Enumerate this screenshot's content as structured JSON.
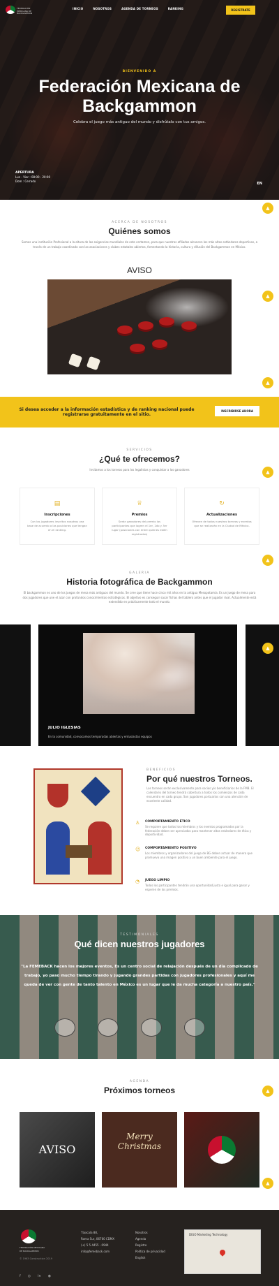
{
  "header": {
    "logo_text": "FEDERACIÓN MEXICANA DE BACKGAMMON",
    "nav": [
      "INICIO",
      "NOSOTROS",
      "AGENDA DE TORNEOS",
      "RANKING"
    ],
    "register_button": "REGISTRATE"
  },
  "hero": {
    "welcome": "BIENVENIDO A",
    "title": "Federación Mexicana de Backgammon",
    "subtitle": "Celebra el juego más antiguo del mundo y disfrútalo con tus amigos.",
    "hours_title": "APERTURA",
    "hours_week": "Lun - Vier : 08:00 - 20:00",
    "hours_sun": "Dom : Cerrado",
    "language": "EN"
  },
  "about": {
    "eyebrow": "ACERCA DE NOSOTROS",
    "title": "Quiénes somos",
    "text": "Somos una institución Profesional a la altura de las exigencias mundiales de este certamen, para que nuestros afiliados alcancen los más altos estándares deportivos, a través de un trabajo coordinado con las asociaciones y clubes estatales abiertos, fomentando la historia, cultura y difusión del Backgammon en México.",
    "aviso_title": "AVISO"
  },
  "cta_band": {
    "text": "Si desea acceder a la información estadística y de ranking nacional puede registrarse gratuitamente en el sitio.",
    "button": "INSCRIBIRSE AHORA"
  },
  "services": {
    "eyebrow": "SERVICIOS",
    "title": "¿Qué te ofrecemos?",
    "subtitle": "Invitamos a los torneos para los legalistas y conquistar a los ganadores",
    "cards": [
      {
        "icon": "registration-icon",
        "title": "Inscripciones",
        "text": "Con los jugadores inscritos nosotros una base de acuerdo a las posiciones que tengan en el ranking."
      },
      {
        "icon": "trophy-icon",
        "title": "Premios",
        "text": "Serán ganadores del premio los participantes que logren el 1er, 2do y 3er lugar (posiciones con entre quienes estén registrados)"
      },
      {
        "icon": "refresh-icon",
        "title": "Actualizaciones",
        "text": "Ofrecen de todos nuestros torneos y eventos que se realizarán en la Ciudad de México."
      }
    ]
  },
  "gallery": {
    "eyebrow": "GALERIA",
    "title": "Historia fotográfica de Backgammon",
    "text": "El backgammon es uno de los juegos de mesa más antiguos del mundo. Se cree que tiene hace cinco mil años en la antigua Mesopotamia. Es un juego de mesa para dos jugadores que une el azar con profundos conocimientos estratégicos. El objetivo es conseguir sacar fichas del tablero antes que el jugador rival. Actualmente está extendido en prácticamente todo el mundo.",
    "caption": "JULIO IGLESIAS",
    "caption_sub": "En la comunidad, convocamos temporadas abiertas y entusiastas equipos"
  },
  "benefits": {
    "eyebrow": "BENEFICIOS",
    "title": "Por qué nuestros Torneos.",
    "text": "Los torneos serán exclusivamente para socios y/o beneficiarios de la FMB. El calendario del torneo tendrá cobertura a todos los comienzos de cada encuentro en cada grupo. Son jugadores portuarios con una atención de excelente calidad.",
    "items": [
      {
        "icon": "shield-icon",
        "title": "COMPORTAMIENTO ÉTICO",
        "text": "Se requiere que todos los miembros y los eventos programados por la federación deben ser apreciados para mantener altos estándares de ética y deportividad."
      },
      {
        "icon": "smile-icon",
        "title": "COMPORTAMIENTO POSITIVO",
        "text": "Los miembros y organizadores del juego de BG deben actuar de manera que promueva una imagen positiva y un buen ambiente para el juego."
      },
      {
        "icon": "clock-icon",
        "title": "JUEGO LIMPIO",
        "text": "Todos los participantes tendrán una oportunidad justa e igual para ganar y esperen de los premios."
      }
    ]
  },
  "testimonials": {
    "eyebrow": "TESTIMONIALES",
    "title": "Qué dicen nuestros jugadores",
    "quote": "\"La FEMEBACK hacen los mejores eventos, Es un centro social de relajación después de un día complicado de trabajo, yo paso mucho tiempo tirando y jugando grandes partidas con jugadores profesionales y aquí me queda de ver con gente de tanto talento en México es un lugar que le da mucha categoría a nuestro país.\""
  },
  "events": {
    "eyebrow": "AGENDA",
    "title": "Próximos torneos",
    "items": [
      "AVISO",
      "Merry Christmas",
      ""
    ]
  },
  "footer": {
    "brand": "FEDERACIÓN MEXICANA DE BACKGAMMON",
    "copyright": "© 1963 Construction 2019",
    "address": [
      "Tlaxcala 88,",
      "Roma Sur, 06760 CDMX",
      "(+) 5 5 4455 - 0944",
      "info@femeback.com"
    ],
    "links": [
      "Nosotros",
      "Agenda",
      "Registro",
      "Política de privacidad",
      "English"
    ],
    "map_label": "DIGO Marketing Technology"
  },
  "colors": {
    "accent": "#f2c31a",
    "dark": "#26221f"
  }
}
